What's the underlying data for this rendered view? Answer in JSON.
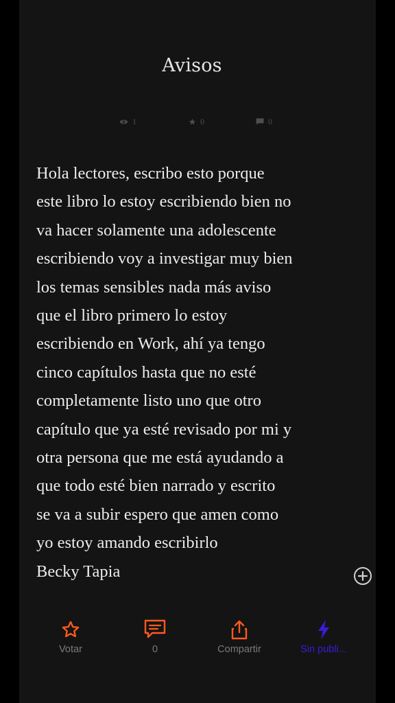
{
  "story": {
    "title": "Avisos",
    "stats": {
      "reads": "1",
      "votes": "0",
      "comments": "0"
    },
    "body_lines": [
      "Hola lectores, escribo esto porque",
      "este libro lo estoy escribiendo bien no",
      "va hacer solamente una adolescente",
      "escribiendo voy a investigar muy bien",
      "los temas sensibles nada más aviso",
      "que el libro primero lo estoy",
      "escribiendo en Work, ahí ya tengo",
      "cinco capítulos hasta que no esté",
      "completamente listo uno que otro",
      "capítulo que ya esté revisado por mi y",
      "otra persona que me está ayudando a",
      "que todo esté bien narrado y escrito",
      "se va a subir espero que amen como",
      "yo estoy amando escribirlo",
      "Becky Tapia"
    ]
  },
  "icons": {
    "reads": "eye-icon",
    "votes": "star-icon",
    "comments": "comment-icon",
    "add": "plus-circle-icon",
    "vote_action": "star-outline-icon",
    "comment_action": "comment-outline-icon",
    "share_action": "share-icon",
    "publish_action": "lightning-icon"
  },
  "bottom_bar": {
    "vote_label": "Votar",
    "comment_count": "0",
    "share_label": "Compartir",
    "publish_label": "Sin publi..."
  },
  "colors": {
    "background": "#141414",
    "text": "#ececec",
    "accent_orange": "#ff5a1f",
    "accent_purple": "#3b1bd9",
    "muted": "#4e4e4e"
  }
}
